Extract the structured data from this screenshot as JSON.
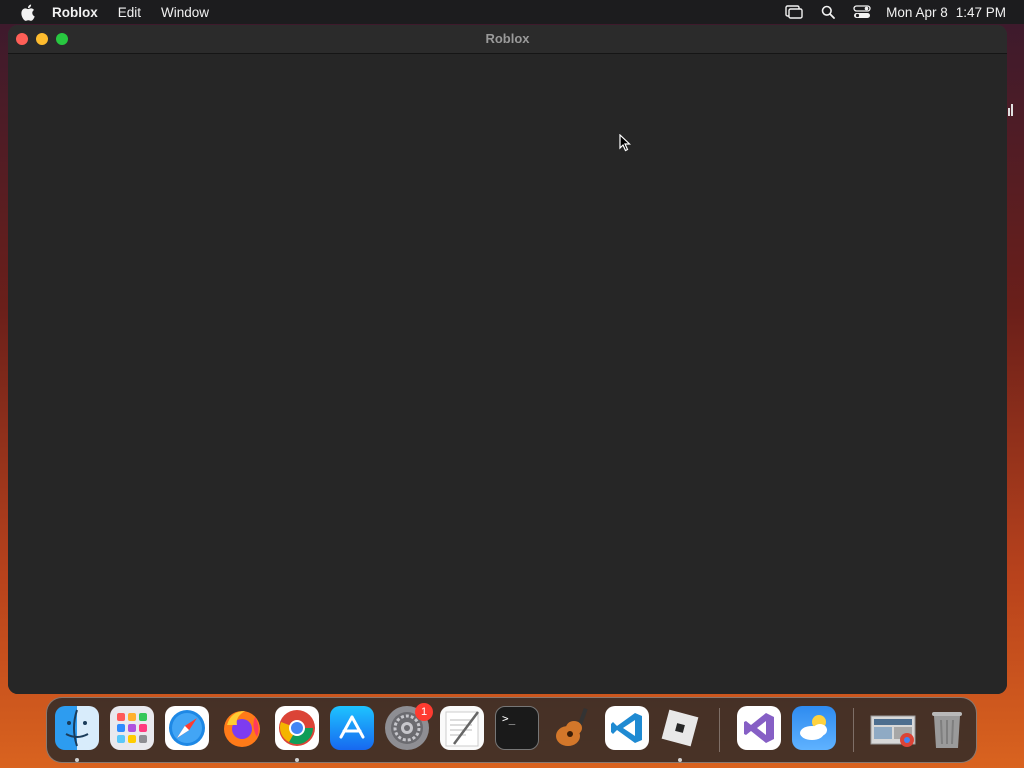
{
  "menubar": {
    "app_name": "Roblox",
    "menus": [
      "Edit",
      "Window"
    ],
    "status_icons": [
      "screen-mirroring-icon",
      "search-icon",
      "control-center-icon"
    ],
    "date": "Mon Apr 8",
    "time": "1:47 PM"
  },
  "window": {
    "title": "Roblox"
  },
  "dock": {
    "apps": [
      {
        "name": "Finder",
        "icon": "finder-icon",
        "running": true
      },
      {
        "name": "Launchpad",
        "icon": "launchpad-icon",
        "running": false
      },
      {
        "name": "Safari",
        "icon": "safari-icon",
        "running": false
      },
      {
        "name": "Firefox",
        "icon": "firefox-icon",
        "running": false
      },
      {
        "name": "Google Chrome",
        "icon": "chrome-icon",
        "running": true
      },
      {
        "name": "App Store",
        "icon": "app-store-icon",
        "running": false
      },
      {
        "name": "System Settings",
        "icon": "settings-icon",
        "running": false,
        "badge": "1"
      },
      {
        "name": "TextEdit",
        "icon": "textedit-icon",
        "running": false
      },
      {
        "name": "Terminal",
        "icon": "terminal-icon",
        "running": false
      },
      {
        "name": "GarageBand",
        "icon": "garageband-icon",
        "running": false
      },
      {
        "name": "Visual Studio Code",
        "icon": "vscode-icon",
        "running": false
      },
      {
        "name": "Roblox",
        "icon": "roblox-icon",
        "running": true
      },
      {
        "name": "Visual Studio",
        "icon": "visual-studio-icon",
        "running": false
      },
      {
        "name": "Weather",
        "icon": "weather-icon",
        "running": false
      },
      {
        "name": "Downloads",
        "icon": "downloads-stack-icon",
        "running": false
      },
      {
        "name": "Trash",
        "icon": "trash-icon",
        "running": false
      }
    ],
    "terminal_prompt": ">_",
    "settings_badge": "1"
  },
  "colors": {
    "window_bg": "#262626",
    "menubar_bg": "#1c1c1e",
    "close": "#ff5f57",
    "minimize": "#febc2e",
    "zoom": "#28c840"
  }
}
